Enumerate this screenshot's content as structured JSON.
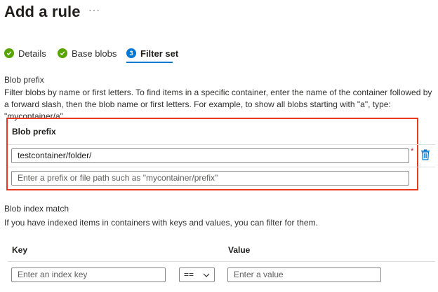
{
  "header": {
    "title": "Add a rule",
    "more": "···"
  },
  "tabs": [
    {
      "label": "Details",
      "state": "completed"
    },
    {
      "label": "Base blobs",
      "state": "completed"
    },
    {
      "label": "Filter set",
      "state": "active",
      "number": "3"
    }
  ],
  "blob_prefix_section": {
    "heading": "Blob prefix",
    "description": "Filter blobs by name or first letters. To find items in a specific container, enter the name of the container followed by a forward slash, then the blob name or first letters. For example, to show all blobs starting with \"a\", type: \"mycontainer/a\".",
    "column_label": "Blob prefix",
    "rows": [
      {
        "value": "testcontainer/folder/",
        "required_marker": "*"
      }
    ],
    "new_row_placeholder": "Enter a prefix or file path such as \"mycontainer/prefix\""
  },
  "index_section": {
    "heading": "Blob index match",
    "description": "If you have indexed items in containers with keys and values, you can filter for them.",
    "key_label": "Key",
    "value_label": "Value",
    "key_placeholder": "Enter an index key",
    "operator": "==",
    "value_placeholder": "Enter a value"
  },
  "colors": {
    "accent": "#0078d4",
    "success": "#57a300",
    "highlight": "#e8381f"
  }
}
